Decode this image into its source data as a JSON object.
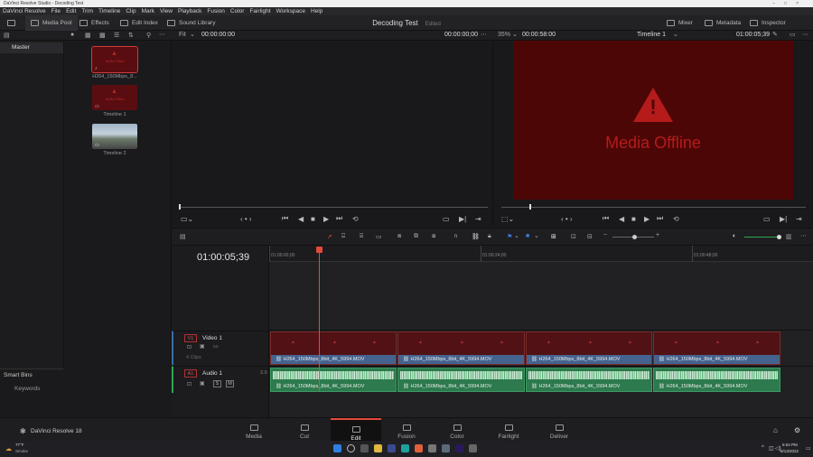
{
  "window": {
    "title": "DaVinci Resolve Studio - Decoding Test"
  },
  "menu": [
    "DaVinci Resolve",
    "File",
    "Edit",
    "Trim",
    "Timeline",
    "Clip",
    "Mark",
    "View",
    "Playback",
    "Fusion",
    "Color",
    "Fairlight",
    "Workspace",
    "Help"
  ],
  "toolbar": {
    "media_pool": "Media Pool",
    "effects": "Effects",
    "edit_index": "Edit Index",
    "sound_library": "Sound Library",
    "project_title": "Decoding Test",
    "project_status": "Edited",
    "mixer": "Mixer",
    "metadata": "Metadata",
    "inspector": "Inspector"
  },
  "source_viewer": {
    "fit": "Fit",
    "timecode_left": "00:00:00:00",
    "timecode_right": "00:00:00;00"
  },
  "timeline_viewer": {
    "zoom": "35%",
    "duration": "00:00:58:00",
    "timeline_name": "Timeline 1",
    "timecode": "01:00:05;39"
  },
  "bins": {
    "master": "Master",
    "smart_bins": "Smart Bins",
    "keywords": "Keywords"
  },
  "media_pool_items": [
    {
      "label": "H264_150Mbps_8...",
      "badge": "Media Offline"
    },
    {
      "label": "Timeline 1",
      "badge": "Media Offline"
    },
    {
      "label": "Timeline 2",
      "badge": ""
    }
  ],
  "offline": {
    "text": "Media Offline"
  },
  "timeline": {
    "timecode": "01:00:05;39",
    "ruler_labels": [
      "01:00:00;00",
      "01:00:24;00",
      "01:00:48;00"
    ],
    "video_track": {
      "id": "V1",
      "name": "Video 1",
      "count": "4 Clips"
    },
    "audio_track": {
      "id": "A1",
      "name": "Audio 1",
      "level": "2.0",
      "solo": "S",
      "mute": "M"
    },
    "clip_name": "H264_150Mbps_8bit_4K_5994.MOV",
    "clip_name_cut": "H264_150Mbps_8bit_4K_5994.MOV",
    "badge": "Media Offline"
  },
  "pages": [
    "Media",
    "Cut",
    "Edit",
    "Fusion",
    "Color",
    "Fairlight",
    "Deliver"
  ],
  "app_brand": "DaVinci Resolve 18",
  "taskbar": {
    "weather_temp": "77°F",
    "weather_desc": "Smoke",
    "time": "5:04 PM",
    "date": "8/13/2022"
  },
  "colors": {
    "accent": "#e34a3a",
    "video_clip": "#521215",
    "audio_clip": "#2c7a4d",
    "clip_bar": "#45638f",
    "offline_bg": "#4d0606",
    "offline_fg": "#b51b1b"
  }
}
